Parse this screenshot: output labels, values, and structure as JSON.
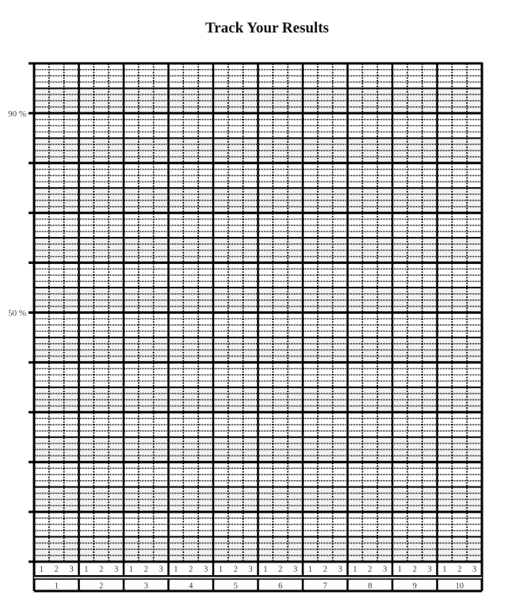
{
  "chart_data": {
    "type": "table",
    "title": "Track Your Results",
    "subtitle": "",
    "xlabel": "",
    "ylabel": "",
    "grid": true,
    "y_axis": {
      "range_percent": [
        0,
        100
      ],
      "major_divisions": 10,
      "labeled_ticks": [
        {
          "value": 90,
          "label": "90 %"
        },
        {
          "value": 50,
          "label": "50 %"
        }
      ],
      "minor_rows_per_major": 8
    },
    "x_axis": {
      "groups": [
        "1",
        "2",
        "3",
        "4",
        "5",
        "6",
        "7",
        "8",
        "9",
        "10"
      ],
      "subdivisions": [
        "1",
        "2",
        "3"
      ]
    },
    "series": [],
    "colors": {
      "line": "#000000",
      "shade": "#f1f1f1",
      "separator": "#c8c8c8"
    }
  }
}
